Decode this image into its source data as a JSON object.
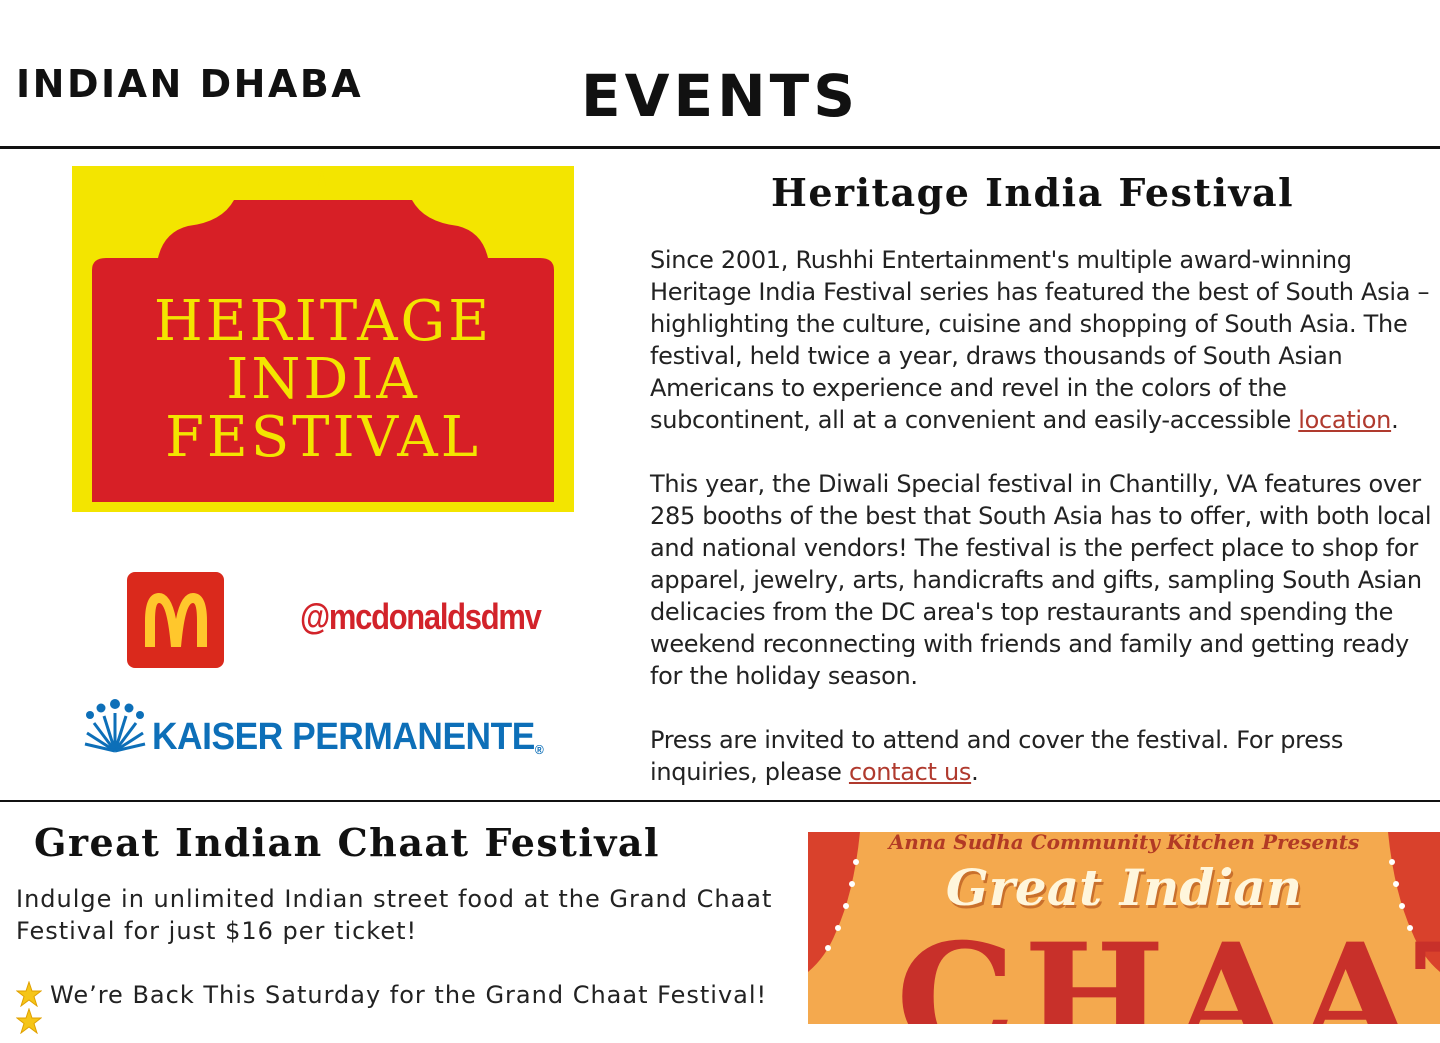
{
  "header": {
    "brand": "INDIAN DHABA",
    "page_title": "EVENTS"
  },
  "heritage": {
    "title": "Heritage India Festival",
    "logo_text": [
      "HERITAGE",
      "INDIA",
      "FESTIVAL"
    ],
    "paragraphs": [
      {
        "text": "Since 2001, Rushhi Entertainment's multiple award-winning Heritage India Festival series has featured the best of South Asia – highlighting the culture, cuisine and shopping of South Asia. The festival, held twice a year, draws thousands of South Asian Americans to experience and revel in the colors of the subcontinent, all at a convenient and easily-accessible ",
        "link": "location",
        "after": "."
      },
      {
        "text": "This year, the Diwali Special festival in Chantilly, VA features over 285 booths of the best that South Asia has to offer, with both local and national vendors! The festival is the perfect place to shop for apparel, jewelry, arts, handicrafts and gifts, sampling South Asian delicacies from the DC area's top restaurants and spending the weekend reconnecting with friends and family and getting ready for the holiday season."
      },
      {
        "text": "Press are invited to attend and cover the festival. For press inquiries, please ",
        "link": "contact us",
        "after": "."
      }
    ],
    "sponsors": {
      "mcdonalds_handle": "@mcdonaldsdmv",
      "kaiser": "KAISER PERMANENTE",
      "kaiser_mark": "®"
    },
    "colors": {
      "logo_red": "#d71f26",
      "logo_yellow": "#f3e500",
      "link": "#b03a2e"
    }
  },
  "chaat": {
    "title": "Great Indian Chaat Festival",
    "intro": "Indulge in unlimited Indian street food at the Grand Chaat Festival for just $16 per ticket!",
    "announcement": "We’re Back This Saturday for the Grand Chaat Festival!",
    "poster": {
      "presents": "Anna Sudha Community Kitchen Presents",
      "great": "Great Indian",
      "chaat": "CHAAT"
    }
  },
  "icons": [
    "mcdonalds-logo-icon",
    "kaiser-permanente-logo-icon",
    "star-icon"
  ]
}
